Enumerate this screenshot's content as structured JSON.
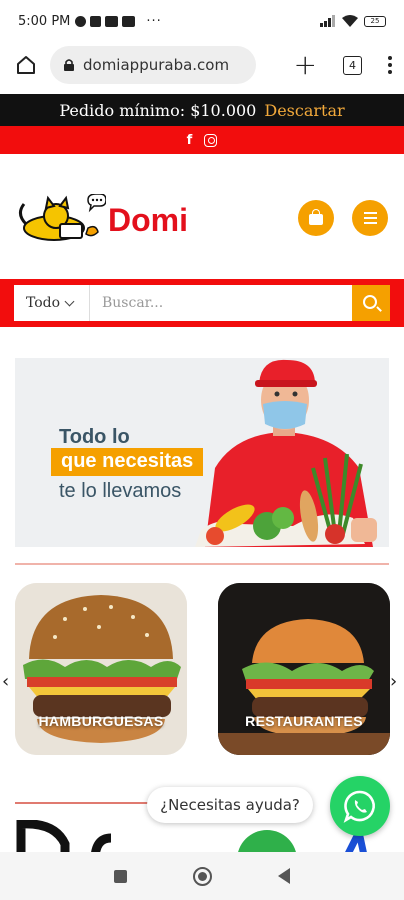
{
  "status_bar": {
    "time": "5:00 PM",
    "more": "···",
    "battery": "25"
  },
  "browser": {
    "url": "domiappuraba.com",
    "tab_count": "4"
  },
  "promo": {
    "text": "Pedido mínimo: $10.000",
    "dismiss": "Descartar"
  },
  "social": {
    "facebook": "f"
  },
  "brand": {
    "name": "Domi"
  },
  "search": {
    "category": "Todo",
    "placeholder": "Buscar..."
  },
  "hero": {
    "line1": "Todo lo",
    "line2": "que necesitas",
    "line3": "te lo llevamos"
  },
  "categories": [
    {
      "label": "HAMBURGUESAS"
    },
    {
      "label": "RESTAURANTES"
    }
  ],
  "carousel": {
    "prev": "‹",
    "next": "›"
  },
  "help": {
    "text": "¿Necesitas ayuda?"
  },
  "colors": {
    "red": "#f20d0d",
    "orange": "#f5a000",
    "whatsapp": "#25d366",
    "dark": "#111111"
  },
  "icons": [
    "home-icon",
    "lock-icon",
    "plus-icon",
    "tabs-icon",
    "more-icon",
    "facebook-icon",
    "instagram-icon",
    "bag-icon",
    "menu-icon",
    "chevron-down-icon",
    "search-icon",
    "whatsapp-icon"
  ]
}
